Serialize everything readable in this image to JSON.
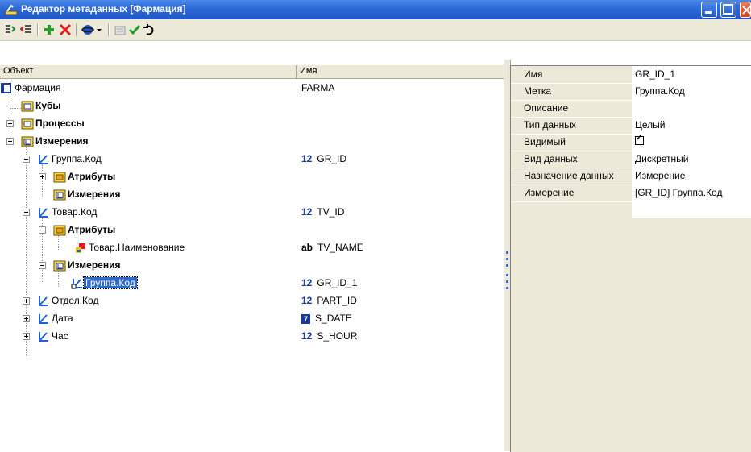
{
  "window": {
    "title": "Редактор метаданных [Фармация]"
  },
  "tree": {
    "columns": {
      "object": "Объект",
      "name": "Имя"
    },
    "rows": [
      {
        "label": "Фармация",
        "value": "FARMA"
      },
      {
        "label": "Кубы"
      },
      {
        "label": "Процессы"
      },
      {
        "label": "Измерения"
      },
      {
        "label": "Группа.Код",
        "type": "12",
        "value": "GR_ID"
      },
      {
        "label": "Атрибуты"
      },
      {
        "label": "Измерения"
      },
      {
        "label": "Товар.Код",
        "type": "12",
        "value": "TV_ID"
      },
      {
        "label": "Атрибуты"
      },
      {
        "label": "Товар.Наименование",
        "type": "ab",
        "value": "TV_NAME"
      },
      {
        "label": "Измерения"
      },
      {
        "label": "Группа.Код",
        "type": "12",
        "value": "GR_ID_1"
      },
      {
        "label": "Отдел.Код",
        "type": "12",
        "value": "PART_ID"
      },
      {
        "label": "Дата",
        "type": "7",
        "value": "S_DATE"
      },
      {
        "label": "Час",
        "type": "12",
        "value": "S_HOUR"
      }
    ]
  },
  "properties": [
    {
      "name": "Имя",
      "value": "GR_ID_1"
    },
    {
      "name": "Метка",
      "value": "Группа.Код"
    },
    {
      "name": "Описание",
      "value": ""
    },
    {
      "name": "Тип данных",
      "value": "Целый"
    },
    {
      "name": "Видимый",
      "value": "",
      "checked": true
    },
    {
      "name": "Вид данных",
      "value": "Дискретный"
    },
    {
      "name": "Назначение данных",
      "value": "Измерение"
    },
    {
      "name": "Измерение",
      "value": "[GR_ID] Группа.Код"
    }
  ],
  "toolbar": {
    "icons": [
      "expand-all-icon",
      "collapse-all-icon",
      "add-icon",
      "delete-icon",
      "connect-icon",
      "dropdown-icon",
      "properties-icon",
      "apply-icon",
      "undo-icon"
    ]
  },
  "colors": {
    "titlebar": "#2e6bd8",
    "selection": "#316ac5",
    "panel": "#ece9d8"
  }
}
